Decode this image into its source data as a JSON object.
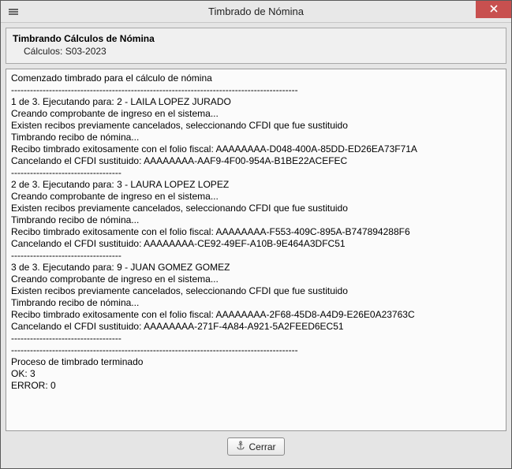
{
  "window": {
    "title": "Timbrado de Nómina"
  },
  "header": {
    "main": "Timbrando Cálculos de Nómina",
    "sub_prefix": "Cálculos: ",
    "sub_value": "S03-2023"
  },
  "log": {
    "lines": [
      "Comenzado timbrado para el cálculo de nómina",
      "-------------------------------------------------------------------------------------------",
      "1 de 3. Ejecutando para: 2 - LAILA LOPEZ JURADO",
      "Creando comprobante de ingreso en el sistema...",
      "Existen recibos previamente cancelados, seleccionando CFDI que fue sustituido",
      "Timbrando recibo de nómina...",
      "Recibo timbrado exitosamente con el folio fiscal: AAAAAAAA-D048-400A-85DD-ED26EA73F71A",
      "Cancelando el CFDI sustituido: AAAAAAAA-AAF9-4F00-954A-B1BE22ACEFEC",
      "-----------------------------------",
      "2 de 3. Ejecutando para: 3 - LAURA LOPEZ LOPEZ",
      "Creando comprobante de ingreso en el sistema...",
      "Existen recibos previamente cancelados, seleccionando CFDI que fue sustituido",
      "Timbrando recibo de nómina...",
      "Recibo timbrado exitosamente con el folio fiscal: AAAAAAAA-F553-409C-895A-B747894288F6",
      "Cancelando el CFDI sustituido: AAAAAAAA-CE92-49EF-A10B-9E464A3DFC51",
      "-----------------------------------",
      "3 de 3. Ejecutando para: 9 - JUAN GOMEZ GOMEZ",
      "Creando comprobante de ingreso en el sistema...",
      "Existen recibos previamente cancelados, seleccionando CFDI que fue sustituido",
      "Timbrando recibo de nómina...",
      "Recibo timbrado exitosamente con el folio fiscal: AAAAAAAA-2F68-45D8-A4D9-E26E0A23763C",
      "Cancelando el CFDI sustituido: AAAAAAAA-271F-4A84-A921-5A2FEED6EC51",
      "-----------------------------------",
      "-------------------------------------------------------------------------------------------",
      "Proceso de timbrado terminado",
      "OK: 3",
      "ERROR: 0"
    ]
  },
  "footer": {
    "close_label": "Cerrar"
  },
  "summary": {
    "ok": 3,
    "error": 0,
    "total": 3
  }
}
